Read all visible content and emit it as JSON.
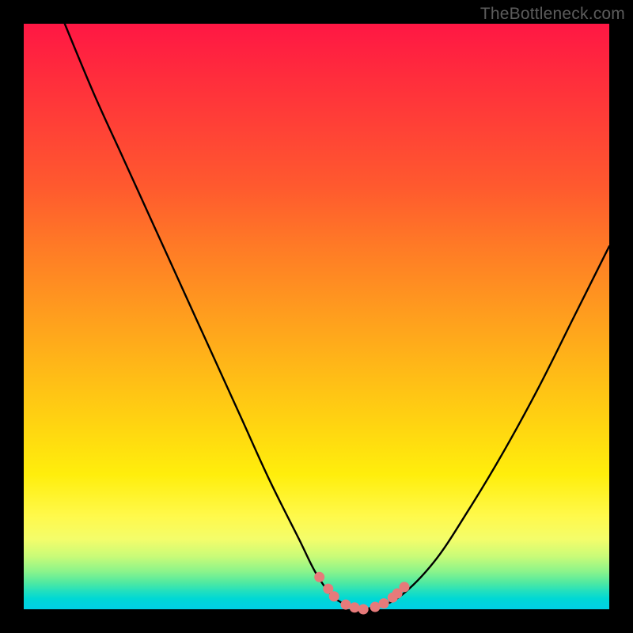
{
  "attribution": "TheBottleneck.com",
  "colors": {
    "frame": "#000000",
    "curve": "#000000",
    "markers": "#e77a7a",
    "gradient_top": "#ff1744",
    "gradient_bottom": "#00d0e4"
  },
  "chart_data": {
    "type": "line",
    "title": "",
    "xlabel": "",
    "ylabel": "",
    "xlim": [
      0,
      100
    ],
    "ylim": [
      0,
      100
    ],
    "grid": false,
    "legend": false,
    "note": "V-shaped bottleneck curve; y is bottleneck percentage (0 at valley = no bottleneck, 100 at top = full bottleneck). Values estimated from pixel geometry.",
    "series": [
      {
        "name": "bottleneck_curve",
        "x": [
          7,
          12,
          17,
          22,
          27,
          32,
          37,
          42,
          47,
          50,
          53,
          56,
          58,
          60,
          64,
          70,
          76,
          82,
          88,
          94,
          100
        ],
        "y": [
          100,
          88,
          77,
          66,
          55,
          44,
          33,
          22,
          12,
          6,
          2,
          0.5,
          0,
          0.5,
          2,
          8,
          17,
          27,
          38,
          50,
          62
        ]
      }
    ],
    "markers": {
      "name": "highlighted_points",
      "x": [
        50.5,
        52,
        53,
        55,
        56.5,
        58,
        60,
        61.5,
        63,
        63.8,
        65
      ],
      "y": [
        5.5,
        3.5,
        2.2,
        0.8,
        0.3,
        0,
        0.4,
        1.0,
        2.0,
        2.7,
        3.8
      ]
    }
  }
}
